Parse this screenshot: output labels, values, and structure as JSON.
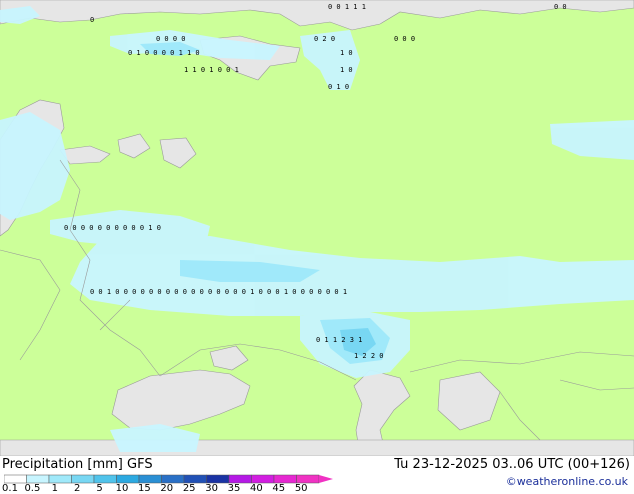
{
  "header": {
    "left_title": "Precipitation [mm]  GFS",
    "right_title": "Tu 23-12-2025 03..06 UTC (00+126)",
    "credit": "©weatheronline.co.uk"
  },
  "legend": {
    "ticks": [
      "0.1",
      "0.5",
      "1",
      "2",
      "5",
      "10",
      "15",
      "20",
      "25",
      "30",
      "35",
      "40",
      "45",
      "50"
    ],
    "colors": [
      "#ffffff",
      "#c8f5ff",
      "#a0e9fa",
      "#78d7f3",
      "#50c3eb",
      "#2ca9e1",
      "#2a8fd4",
      "#2a70c6",
      "#2151b6",
      "#1a33a4",
      "#b519e6",
      "#d21ee1",
      "#e628d2",
      "#f032c3"
    ]
  },
  "map_colors": {
    "land": "#ccff99",
    "sea": "#e6e6e6",
    "precip_light": "#c8f5ff",
    "precip_medium": "#a0e9fa",
    "precip_heavy": "#78d7f3",
    "borders": "#9a9a9a"
  },
  "grid_values": [
    {
      "row": 1,
      "text": "0"
    },
    {
      "row": 1,
      "text": "0 0 1 1 1"
    },
    {
      "row": 1,
      "text": "0 0"
    },
    {
      "row": 2,
      "text": "0 0 0 0"
    },
    {
      "row": 2,
      "text": "0 2 0"
    },
    {
      "row": 2,
      "text": "0 0 0"
    },
    {
      "row": 3,
      "text": "0 1 0 0 0 0 1 1 0"
    },
    {
      "row": 3,
      "text": "1 0"
    },
    {
      "row": 4,
      "text": "1 1 0 1 0 0 1"
    },
    {
      "row": 4,
      "text": "1 0"
    },
    {
      "row": 5,
      "text": "0 1 0"
    },
    {
      "row": 6,
      "text": "0 0 0 0 0 0 0 0 0 0 1 0"
    },
    {
      "row": 7,
      "text": "0 0 1 0 0 0 0 0 0 0 0 0 0 0 0 0 0 0 0 1 0 0 0 1 0 0 0 0 0 0 1"
    },
    {
      "row": 8,
      "text": "0 1 1 2 3 1"
    },
    {
      "row": 9,
      "text": "1 2 2 0"
    }
  ]
}
